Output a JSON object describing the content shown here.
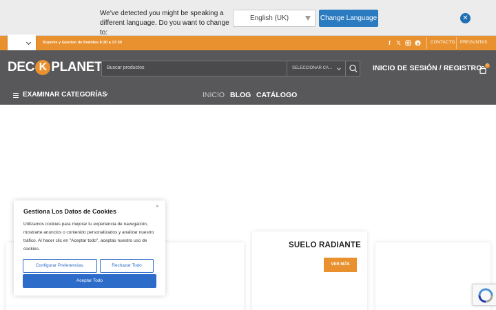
{
  "language_bar": {
    "message": "We've detected you might be speaking a different language. Do you want to change to:",
    "selected_language": "English (UK)",
    "change_button": "Change Language"
  },
  "top_bar": {
    "support_text": "Soporte y Gestion de Pedidos  8:30 a 17:30",
    "social_icons": [
      "facebook-icon",
      "x-icon",
      "instagram-icon",
      "pinterest-icon"
    ],
    "links": [
      "CONTACTO",
      "PREGUNTAS"
    ]
  },
  "header": {
    "logo_pre": "DEC",
    "logo_k": "K",
    "logo_post": "PLANET",
    "search_placeholder": "Buscar productos",
    "category_select": "SELECCIONAR CA...",
    "login_label": "INICIO DE SESIÓN / REGISTRO",
    "cart_count": "0",
    "browse_categories": "EXAMINAR CATEGORÍAS",
    "nav": [
      "INICIO",
      "BLOG",
      "CATÁLOGO"
    ]
  },
  "featured": {
    "card_title": "SUELO RADIANTE",
    "card_button": "VER MÁS"
  },
  "cookie_popup": {
    "title": "Gestiona Los Datos de Cookies",
    "text": "Utilizamos cookies para mejorar tu experiencia de navegación, mostrarte anuncios o contenido personalizados y analizar nuestro tráfico. Al hacer clic en \"Aceptar todo\", aceptas nuestro uso de cookies.",
    "configure_button": "Configurar Preferencias.",
    "reject_button": "Rechazar Todo",
    "accept_button": "Aceptar Todo",
    "close_glyph": "×"
  },
  "colors": {
    "accent_orange": "#e9912e",
    "header_gray": "#58585a",
    "link_blue": "#2e6cc9"
  }
}
